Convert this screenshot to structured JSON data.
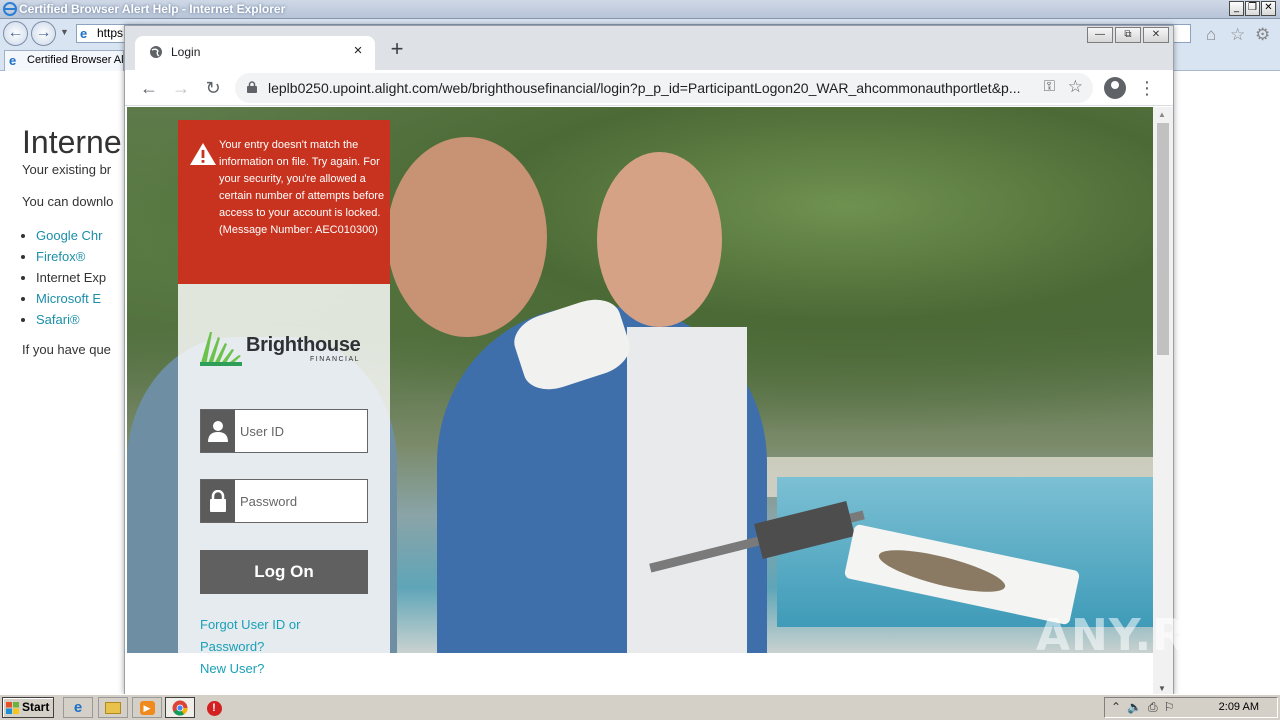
{
  "ie": {
    "window_title": "Certified Browser Alert Help - Internet Explorer",
    "address_value": "https:",
    "tab_label": "Certified Browser Al",
    "page": {
      "heading": "Interne",
      "line1": "Your existing br",
      "line2": "You can downlo",
      "browsers": [
        "Google Chr",
        "Firefox®",
        "Internet Exp",
        "Microsoft E",
        "Safari®"
      ],
      "line3": "If you have que"
    }
  },
  "chrome": {
    "tab_title": "Login",
    "tab_close": "×",
    "new_tab": "+",
    "window_controls": [
      "▭",
      "⧉",
      "✕"
    ],
    "url": "leplb0250.upoint.alight.com/web/brighthousefinancial/login?p_p_id=ParticipantLogon20_WAR_ahcommonauthportlet&p...",
    "icons": [
      "back-icon",
      "forward-icon",
      "reload-icon",
      "lock-icon",
      "key-icon",
      "star-icon",
      "profile-icon",
      "menu-icon"
    ]
  },
  "login": {
    "error_message": "Your entry doesn't match the information on file. Try again. For your security, you're allowed a certain number of attempts before access to your account is locked. (Message Number: AEC010300)",
    "brand_name": "Brighthouse",
    "brand_sub": "FINANCIAL",
    "userid_placeholder": "User ID",
    "password_placeholder": "Password",
    "logon_label": "Log On",
    "forgot_link": "Forgot User ID or Password?",
    "new_user_link": "New User?",
    "colors": {
      "error_bg": "#c8331f",
      "button_bg": "#606060",
      "link": "#1aa0b8",
      "brand_green": "#6cc24a"
    }
  },
  "watermark": "ANY.RUN",
  "taskbar": {
    "start_label": "Start",
    "clock": "2:09 AM",
    "apps": [
      "ie-icon",
      "folder-icon",
      "media-player-icon",
      "chrome-icon",
      "stop-icon"
    ]
  }
}
